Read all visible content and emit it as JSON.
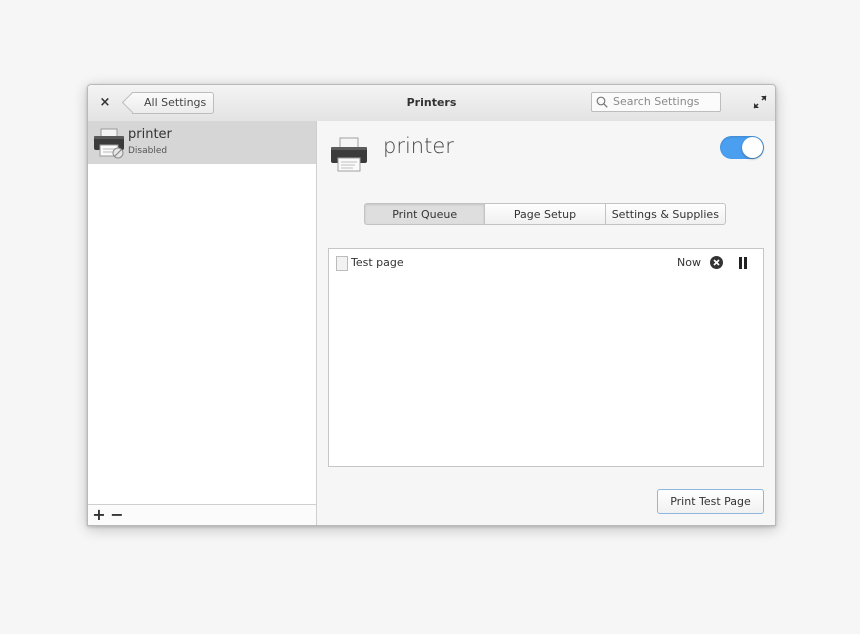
{
  "window": {
    "title": "Printers",
    "back_label": "All Settings",
    "close_glyph": "×",
    "search": {
      "placeholder": "Search Settings"
    }
  },
  "sidebar": {
    "printers": [
      {
        "name": "printer",
        "status": "Disabled",
        "icon": "printer-icon"
      }
    ],
    "toolbar": {
      "add_glyph": "+",
      "remove_glyph": "−"
    }
  },
  "main": {
    "printer_name": "printer",
    "enabled": true,
    "tabs": [
      {
        "label": "Print Queue",
        "active": true
      },
      {
        "label": "Page Setup",
        "active": false
      },
      {
        "label": "Settings & Supplies",
        "active": false
      }
    ],
    "queue": [
      {
        "name": "Test page",
        "time": "Now"
      }
    ],
    "print_test_label": "Print Test Page"
  },
  "colors": {
    "accent": "#4a9ff0",
    "selected_row": "#d6d6d6"
  }
}
